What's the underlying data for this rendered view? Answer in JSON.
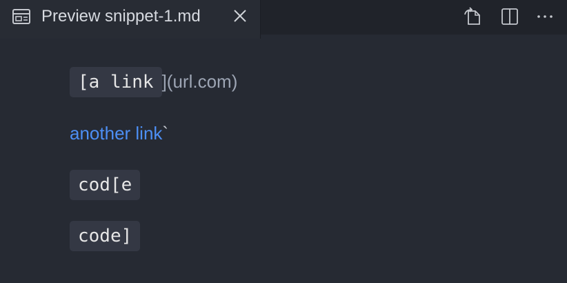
{
  "tab": {
    "title": "Preview snippet-1.md",
    "icon": "preview-icon",
    "close_icon": "close-icon"
  },
  "actions": [
    {
      "name": "open-source",
      "icon": "open-source-icon"
    },
    {
      "name": "split-editor",
      "icon": "split-editor-icon"
    },
    {
      "name": "more-actions",
      "icon": "ellipsis-icon"
    }
  ],
  "content": {
    "line1": {
      "code": "[a link",
      "rest": "](url.com)"
    },
    "line2": {
      "link": "another link",
      "trailing": "`"
    },
    "line3": {
      "code": "cod[e"
    },
    "line4": {
      "code": "code]"
    }
  },
  "colors": {
    "background": "#262a33",
    "titlebar": "#20232a",
    "tab_active": "#282c34",
    "code_bg": "#343844",
    "link": "#4d8ff5",
    "text": "#9da5b4"
  }
}
